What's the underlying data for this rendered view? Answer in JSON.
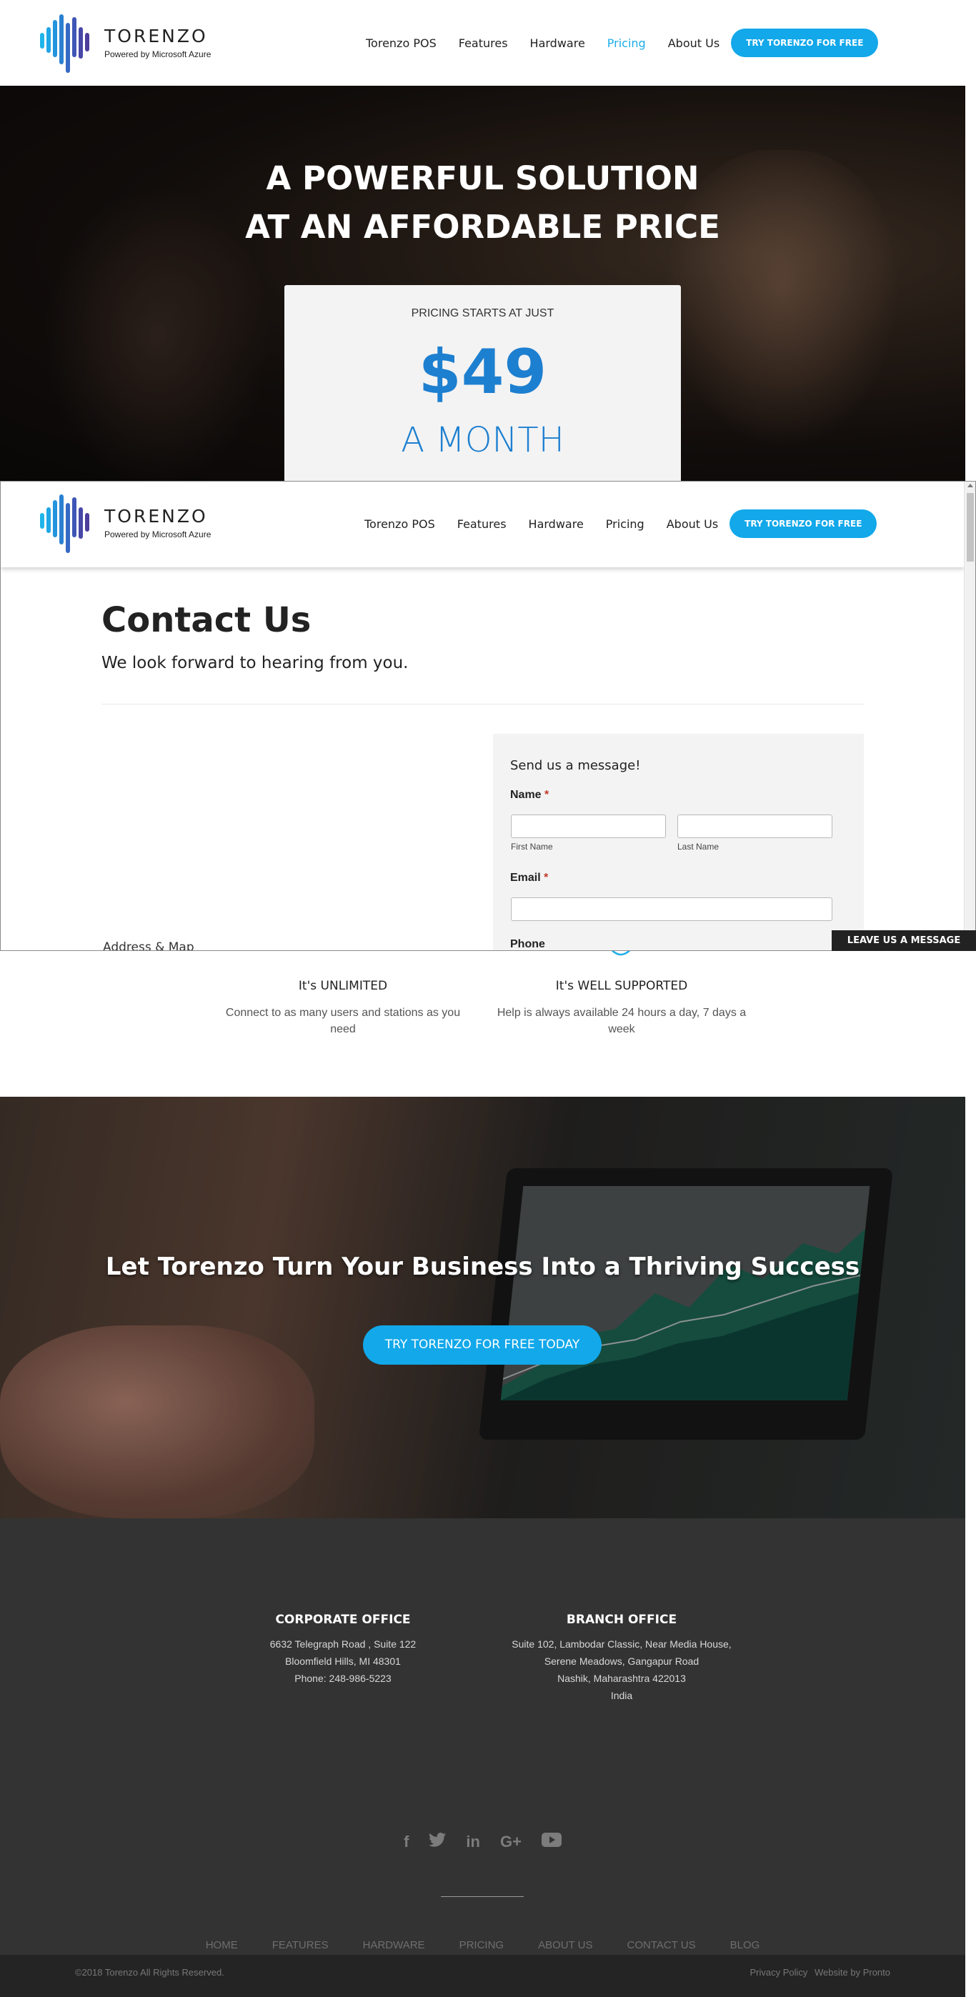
{
  "header": {
    "logo_name": "TORENZO",
    "logo_tagline": "Powered by Microsoft Azure",
    "nav": [
      "Torenzo POS",
      "Features",
      "Hardware",
      "Pricing",
      "About Us"
    ],
    "active_nav": "Pricing",
    "cta": "TRY TORENZO FOR FREE"
  },
  "hero": {
    "title_line1": "A POWERFUL SOLUTION",
    "title_line2": "AT AN AFFORDABLE PRICE",
    "price_label": "PRICING STARTS AT JUST",
    "price": "$49",
    "price_unit": "A MONTH"
  },
  "modal": {
    "header": {
      "logo_name": "TORENZO",
      "logo_tagline": "Powered by Microsoft Azure",
      "nav": [
        "Torenzo POS",
        "Features",
        "Hardware",
        "Pricing",
        "About Us"
      ],
      "cta": "TRY TORENZO FOR FREE"
    },
    "title": "Contact Us",
    "subtitle": "We look forward to hearing from you.",
    "address_label": "Address & Map",
    "form": {
      "heading": "Send us a message!",
      "name_label": "Name",
      "required_mark": "*",
      "first_name_hint": "First Name",
      "last_name_hint": "Last Name",
      "email_label": "Email",
      "phone_label": "Phone",
      "first_name_value": "",
      "last_name_value": "",
      "email_value": ""
    }
  },
  "features": [
    {
      "title": "It's UNLIMITED",
      "desc": "Connect to as many users and stations as you need",
      "icon": "lightbulb-icon"
    },
    {
      "title": "It's WELL SUPPORTED",
      "desc": "Help is always available 24 hours a day, 7 days a week",
      "icon": "support-icon"
    }
  ],
  "cta_band": {
    "title": "Let Torenzo Turn Your Business Into a Thriving Success",
    "button": "TRY TORENZO FOR FREE TODAY"
  },
  "footer": {
    "corporate": {
      "title": "CORPORATE OFFICE",
      "line1": "6632 Telegraph Road , Suite 122",
      "line2": "Bloomfield Hills, MI 48301",
      "line3": "Phone: 248-986-5223"
    },
    "branch": {
      "title": "BRANCH OFFICE",
      "line1": "Suite 102, Lambodar Classic, Near Media House,",
      "line2": "Serene Meadows, Gangapur Road",
      "line3": "Nashik, Maharashtra 422013",
      "line4": "India"
    },
    "social": [
      "f",
      "twitter",
      "in",
      "G+",
      "youtube"
    ],
    "nav": [
      "HOME",
      "FEATURES",
      "HARDWARE",
      "PRICING",
      "ABOUT US",
      "CONTACT US",
      "BLOG"
    ],
    "copyright": "©2018 Torenzo All Rights Reserved.",
    "privacy": "Privacy Policy",
    "credit": "Website by Pronto"
  },
  "chat_tab": "LEAVE US A MESSAGE",
  "colors": {
    "accent": "#12a8ea",
    "price_blue": "#1d7fd0",
    "footer_bg": "#333333",
    "required": "#c0392b"
  }
}
